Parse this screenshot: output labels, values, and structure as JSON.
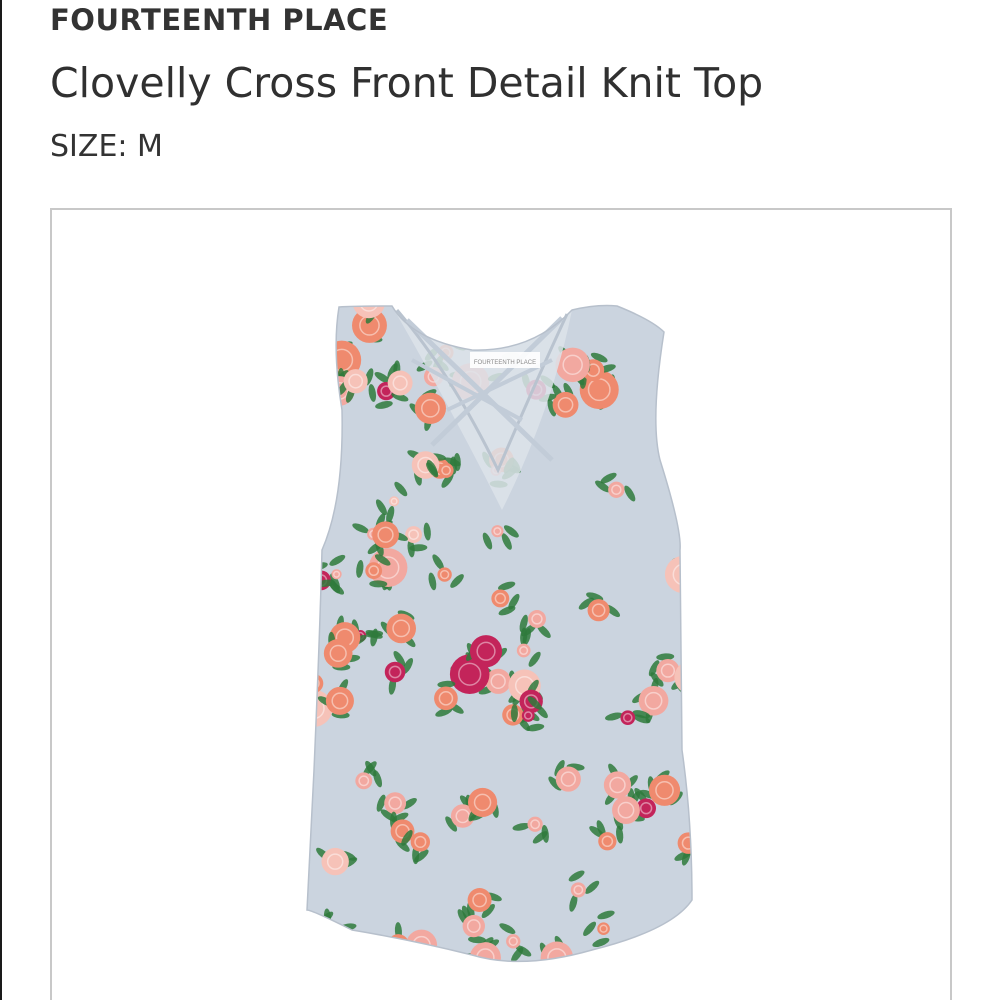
{
  "product": {
    "brand": "FOURTEENTH PLACE",
    "name": "Clovelly Cross Front Detail Knit Top",
    "size_label": "SIZE: M",
    "image_alt": "Floral print sleeveless knit top with cross-front neckline",
    "neck_label_text": "FOURTEENTH PLACE"
  },
  "colors": {
    "fabric": "#c9d2de",
    "rose_pink": "#f2a8a0",
    "coral": "#ef8a6e",
    "magenta": "#c3245a",
    "leaf_green": "#2f7a3c",
    "frame_border": "#c8c8c8"
  }
}
